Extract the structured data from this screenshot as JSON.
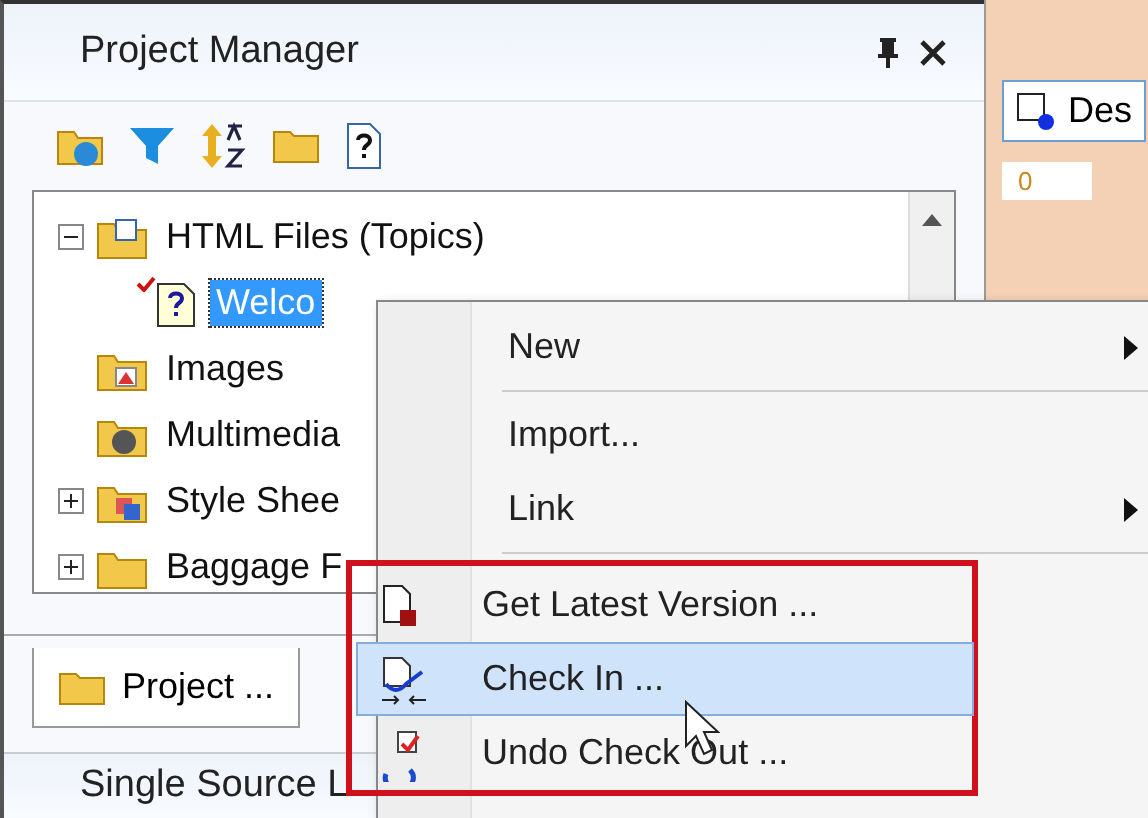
{
  "panel": {
    "title": "Project Manager"
  },
  "tree": [
    {
      "label": "HTML Files (Topics)",
      "expandable": true,
      "expanded": true,
      "selected": false,
      "children": [
        {
          "label": "Welco",
          "selected": true,
          "checked_out": true
        }
      ]
    },
    {
      "label": "Images",
      "selected": false
    },
    {
      "label": "Multimedia",
      "selected": false
    },
    {
      "label": "Style Shee",
      "expandable": true,
      "expanded": false,
      "selected": false
    },
    {
      "label": "Baggage F",
      "expandable": true,
      "expanded": false,
      "selected": false
    }
  ],
  "bottom_tab": {
    "label": "Project ..."
  },
  "second_panel": {
    "title": "Single Source L"
  },
  "editor": {
    "button": "Des",
    "ruler": "0"
  },
  "context_menu": [
    {
      "kind": "item",
      "label": "New",
      "submenu": true,
      "selected": false,
      "highlighted": false
    },
    {
      "kind": "separator"
    },
    {
      "kind": "item",
      "label": "Import...",
      "submenu": false,
      "selected": false,
      "highlighted": false
    },
    {
      "kind": "item",
      "label": "Link",
      "submenu": true,
      "selected": false,
      "highlighted": false
    },
    {
      "kind": "separator"
    },
    {
      "kind": "item",
      "label": "Get Latest Version ...",
      "submenu": false,
      "selected": false,
      "highlighted": true
    },
    {
      "kind": "item",
      "label": "Check In ...",
      "submenu": false,
      "selected": true,
      "highlighted": true
    },
    {
      "kind": "item",
      "label": "Undo Check Out ...",
      "submenu": false,
      "selected": false,
      "highlighted": true
    }
  ]
}
